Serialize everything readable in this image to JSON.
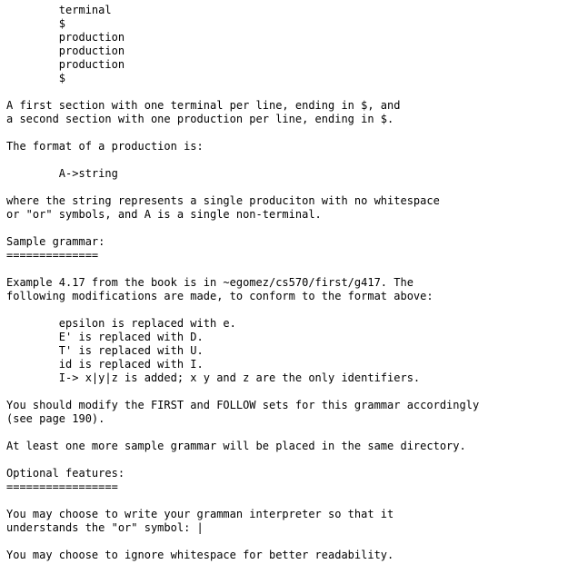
{
  "document": {
    "type": "plain-text-readme",
    "background_color": "#ffffff",
    "text_color": "#000000",
    "indent_spaces": 8,
    "blocks": [
      {
        "id": "format-example-block",
        "kind": "indented-code",
        "lines": [
          "terminal",
          "$",
          "production",
          "production",
          "production",
          "$"
        ]
      },
      {
        "id": "sections-paragraph",
        "kind": "paragraph",
        "lines": [
          "A first section with one terminal per line, ending in $, and",
          "a second section with one production per line, ending in $."
        ]
      },
      {
        "id": "production-format-intro",
        "kind": "paragraph",
        "lines": [
          "The format of a production is:"
        ]
      },
      {
        "id": "production-format-code",
        "kind": "indented-code",
        "lines": [
          "A->string"
        ]
      },
      {
        "id": "production-format-explanation",
        "kind": "paragraph",
        "lines": [
          "where the string represents a single produciton with no whitespace",
          "or \"or\" symbols, and A is a single non-terminal."
        ]
      },
      {
        "id": "sample-grammar-heading",
        "kind": "heading",
        "lines": [
          "Sample grammar:",
          "=============="
        ]
      },
      {
        "id": "example-417-paragraph",
        "kind": "paragraph",
        "lines": [
          "Example 4.17 from the book is in ~egomez/cs570/first/g417. The",
          "following modifications are made, to conform to the format above:"
        ]
      },
      {
        "id": "modifications-list",
        "kind": "indented-code",
        "lines": [
          "epsilon is replaced with e.",
          "E' is replaced with D.",
          "T' is replaced with U.",
          "id is replaced with I.",
          "I-> x|y|z is added; x y and z are the only identifiers."
        ]
      },
      {
        "id": "first-follow-paragraph",
        "kind": "paragraph",
        "lines": [
          "You should modify the FIRST and FOLLOW sets for this grammar accordingly",
          "(see page 190)."
        ]
      },
      {
        "id": "more-grammars-paragraph",
        "kind": "paragraph",
        "lines": [
          "At least one more sample grammar will be placed in the same directory."
        ]
      },
      {
        "id": "optional-features-heading",
        "kind": "heading",
        "lines": [
          "Optional features:",
          "================="
        ]
      },
      {
        "id": "or-symbol-paragraph",
        "kind": "paragraph-with-cursor",
        "lines": [
          "You may choose to write your gramman interpreter so that it",
          "understands the \"or\" symbol: "
        ],
        "trailing_symbol": "|"
      },
      {
        "id": "whitespace-paragraph",
        "kind": "paragraph",
        "lines": [
          "You may choose to ignore whitespace for better readability."
        ]
      }
    ]
  }
}
